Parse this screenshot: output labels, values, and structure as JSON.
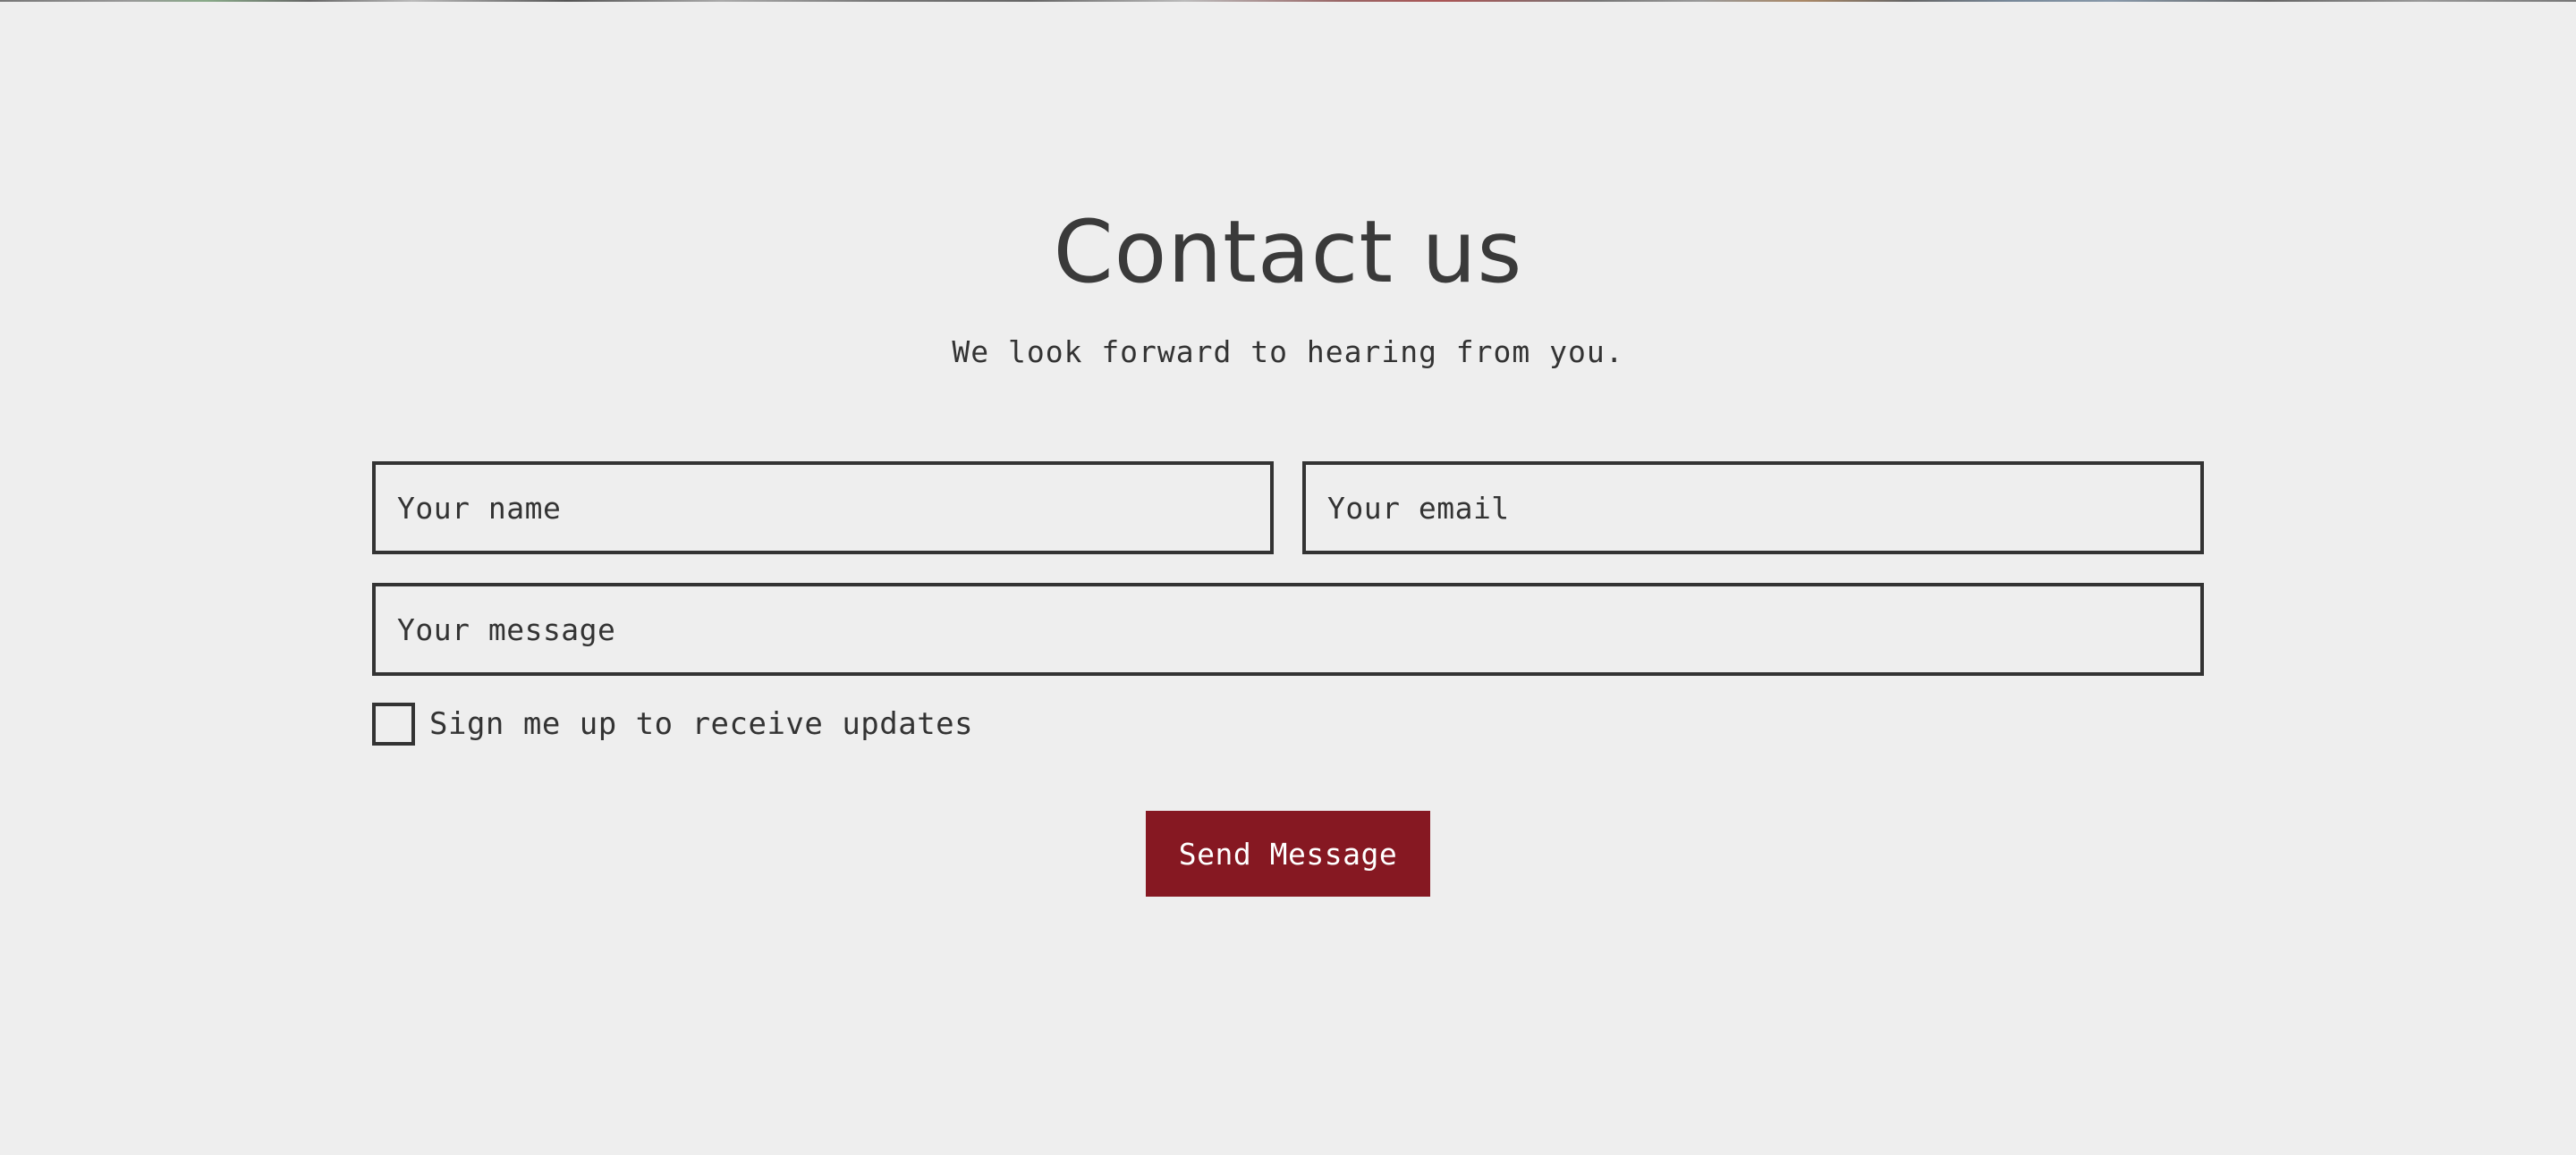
{
  "contact": {
    "title": "Contact us",
    "subtitle": "We look forward to hearing from you.",
    "fields": {
      "name_placeholder": "Your name",
      "email_placeholder": "Your email",
      "message_placeholder": "Your message"
    },
    "updates_checkbox": {
      "label": "Sign me up to receive updates",
      "checked": false
    },
    "submit_label": "Send Message"
  },
  "colors": {
    "background": "#eeeeee",
    "text": "#333333",
    "accent": "#861822",
    "button_text": "#ffffff"
  }
}
